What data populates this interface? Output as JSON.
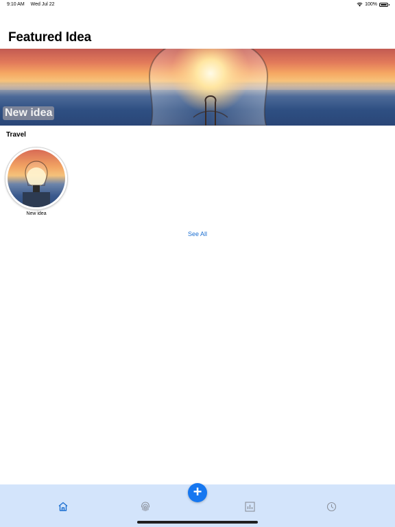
{
  "status_bar": {
    "time": "9:10 AM",
    "date": "Wed Jul 22",
    "battery": "100%"
  },
  "header": {
    "title": "Featured Idea"
  },
  "featured": {
    "label": "New idea"
  },
  "section": {
    "title": "Travel"
  },
  "ideas": [
    {
      "name": "New idea"
    }
  ],
  "see_all": "See All",
  "tab_bar": {
    "tabs": [
      {
        "icon": "home-icon"
      },
      {
        "icon": "fingerprint-icon"
      },
      {
        "icon": "chart-icon"
      },
      {
        "icon": "clock-icon"
      }
    ],
    "add_button": "+",
    "active_color": "#1c6fd1",
    "inactive_color": "#8a8f99",
    "background": "#d3e4fb"
  }
}
